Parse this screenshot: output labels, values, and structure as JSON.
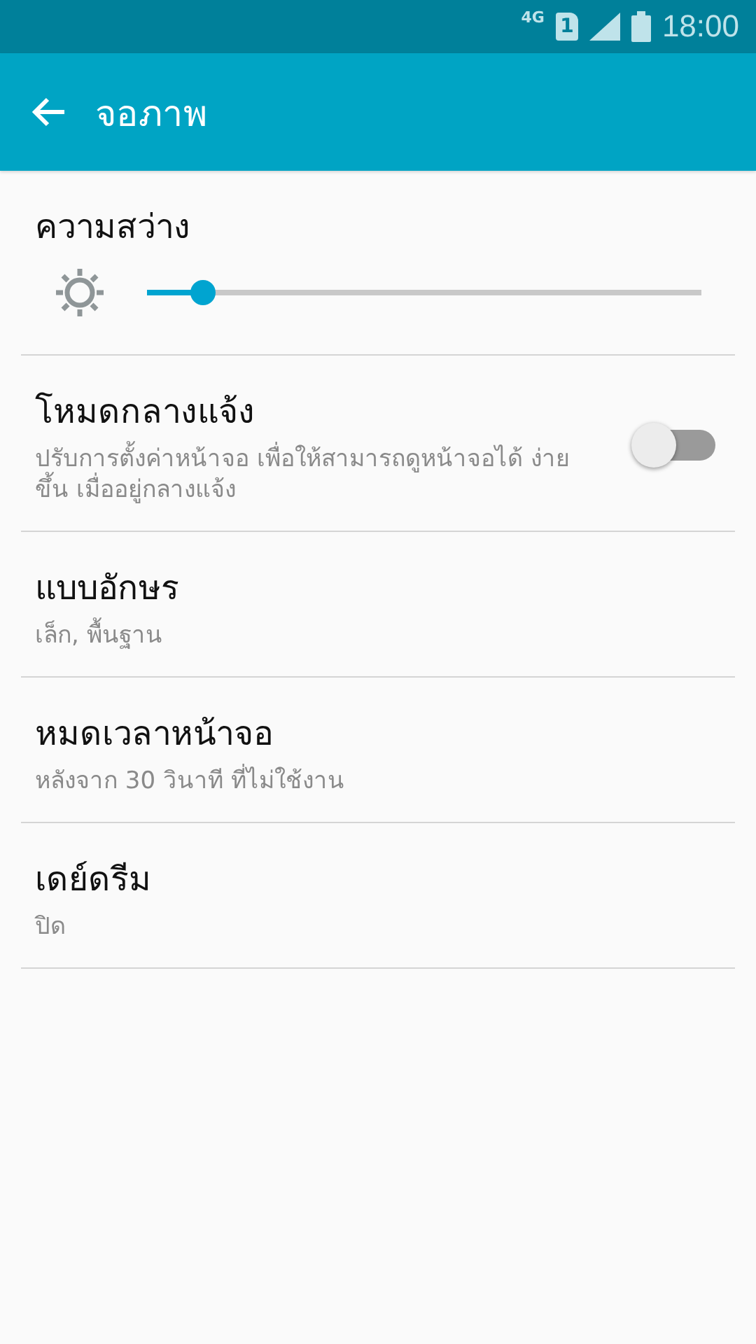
{
  "status_bar": {
    "network": "4G",
    "sim": "1",
    "time": "18:00"
  },
  "app_bar": {
    "title": "จอภาพ"
  },
  "settings": [
    {
      "kind": "slider",
      "title": "ความสว่าง",
      "level": 0.1
    },
    {
      "kind": "toggle",
      "title": "โหมดกลางแจ้ง",
      "summary": "ปรับการตั้งค่าหน้าจอ เพื่อให้สามารถดูหน้าจอได้ ง่ายขึ้น เมื่ออยู่กลางแจ้ง",
      "on": false
    },
    {
      "kind": "text",
      "title": "แบบอักษร",
      "summary": "เล็ก, พื้นฐาน"
    },
    {
      "kind": "text",
      "title": "หมดเวลาหน้าจอ",
      "summary": "หลังจาก 30 วินาที ที่ไม่ใช้งาน"
    },
    {
      "kind": "text",
      "title": "เดย์ดรีม",
      "summary": "ปิด"
    }
  ]
}
